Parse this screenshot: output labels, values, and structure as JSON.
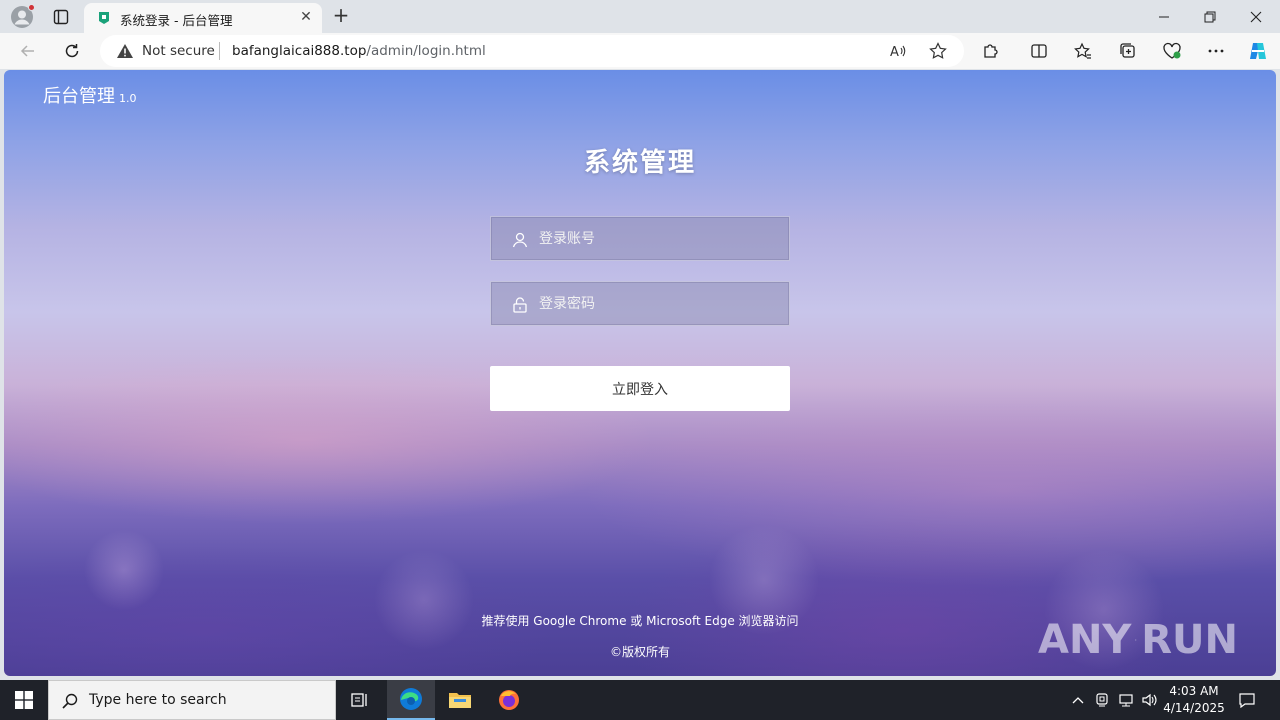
{
  "browser": {
    "tab_title": "系统登录 - 后台管理",
    "address": {
      "security_label": "Not secure",
      "url_host": "bafanglaicai888.top",
      "url_path": "/admin/login.html"
    },
    "icons": {
      "profile": "profile-icon",
      "tab_actions": "tab-actions-icon",
      "favicon": "site-favicon",
      "close_tab": "close-icon",
      "new_tab": "plus-icon",
      "back": "back-arrow-icon",
      "refresh": "refresh-icon",
      "warning": "warning-icon",
      "read_aloud": "read-aloud-icon",
      "favorite": "star-icon",
      "extensions": "puzzle-icon",
      "split_screen": "split-screen-icon",
      "favorites": "favorites-icon",
      "collections": "collections-icon",
      "browser_essentials": "heart-pulse-icon",
      "more": "more-dots-icon",
      "copilot": "copilot-icon"
    },
    "window_controls": [
      "minimize",
      "restore",
      "close"
    ],
    "colors": {
      "chrome_bg": "#dfe3e8",
      "toolbar_bg": "#f7f7f7",
      "warning": "#444444"
    }
  },
  "page": {
    "brand": "后台管理",
    "brand_version": "1.0",
    "title": "系统管理",
    "username_placeholder": "登录账号",
    "password_placeholder": "登录密码",
    "login_button": "立即登入",
    "browser_tip": "推荐使用 Google Chrome 或 Microsoft Edge 浏览器访问",
    "copyright": "©版权所有",
    "watermark": {
      "left": "ANY",
      "right": "RUN"
    },
    "colors": {
      "button_bg": "#ffffff",
      "text": "#ffffff"
    }
  },
  "taskbar": {
    "search_placeholder": "Type here to search",
    "time": "4:03 AM",
    "date": "4/14/2025",
    "apps": [
      "task-view-icon",
      "edge-icon",
      "file-explorer-icon",
      "firefox-icon"
    ],
    "tray_icons": [
      "chevron-up-icon",
      "meet-now-icon",
      "network-icon",
      "volume-icon"
    ],
    "colors": {
      "bg": "#1f2229",
      "active_underline": "#76b9ed"
    }
  }
}
